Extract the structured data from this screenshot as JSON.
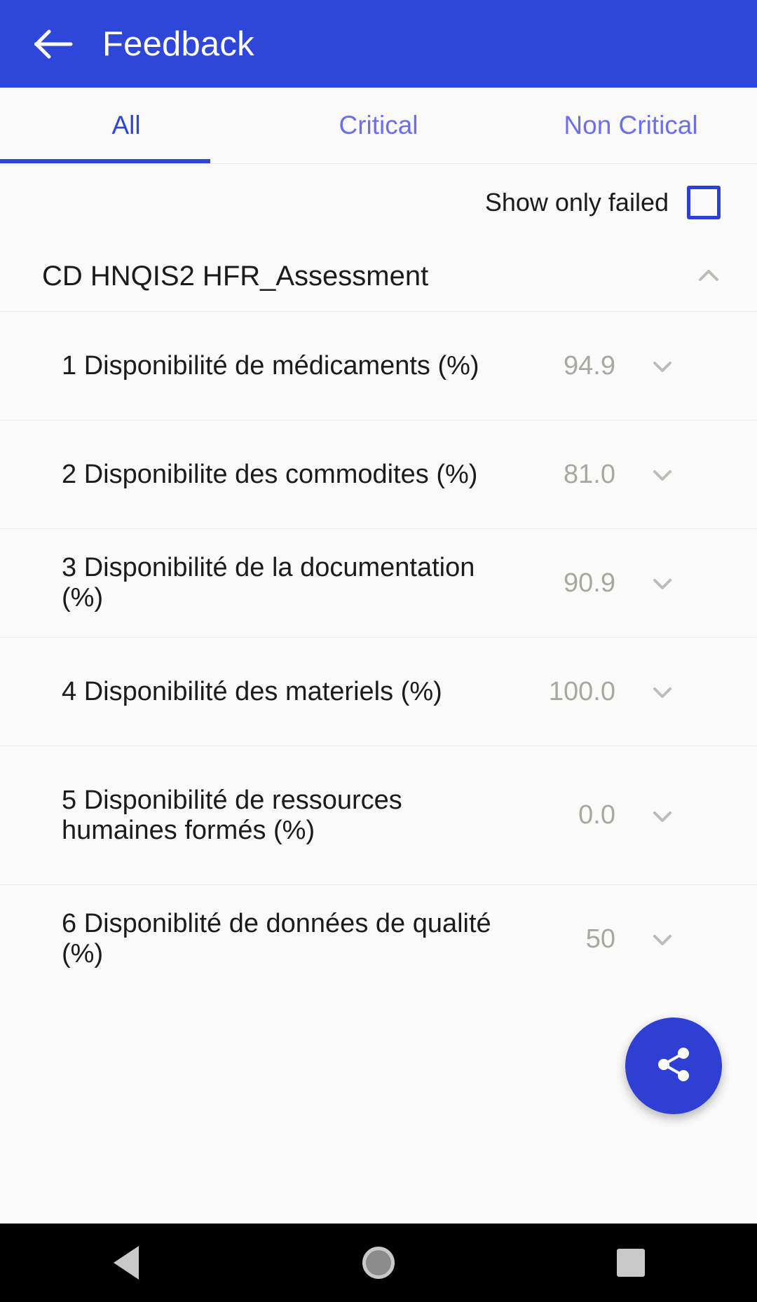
{
  "appbar": {
    "title": "Feedback",
    "back_icon": "arrow-left-icon",
    "background_color": "#2f47d8",
    "title_color": "#ffffff"
  },
  "tabs": {
    "active_index": 0,
    "items": [
      {
        "label": "All"
      },
      {
        "label": "Critical"
      },
      {
        "label": "Non Critical"
      }
    ],
    "active_color": "#2f47d8",
    "inactive_color": "#6b6ef0"
  },
  "filter": {
    "label": "Show only failed",
    "checked": false,
    "checkbox_color": "#2f3fd4"
  },
  "section": {
    "title": "CD HNQIS2 HFR_Assessment",
    "expanded": true,
    "toggle_icon": "chevron-up-icon"
  },
  "list": {
    "items": [
      {
        "label": "1 Disponibilité de médicaments (%)",
        "value": "94.9",
        "expand_icon": "chevron-down-icon"
      },
      {
        "label": "2 Disponibilite des commodites (%)",
        "value": "81.0",
        "expand_icon": "chevron-down-icon"
      },
      {
        "label": "3 Disponibilité de la documentation (%)",
        "value": "90.9",
        "expand_icon": "chevron-down-icon"
      },
      {
        "label": "4 Disponibilité des materiels (%)",
        "value": "100.0",
        "expand_icon": "chevron-down-icon"
      },
      {
        "label": "5 Disponibilité de ressources humaines formés (%)",
        "value": "0.0",
        "expand_icon": "chevron-down-icon"
      },
      {
        "label": "6 Disponiblité de données de qualité (%)",
        "value": "50",
        "expand_icon": "chevron-down-icon"
      }
    ],
    "value_color": "#a9a79e"
  },
  "fab": {
    "icon": "share-icon",
    "color": "#2f3fd4"
  },
  "navbar": {
    "back_icon": "nav-back-triangle-icon",
    "home_icon": "nav-home-circle-icon",
    "recents_icon": "nav-recents-square-icon",
    "background_color": "#000000"
  }
}
